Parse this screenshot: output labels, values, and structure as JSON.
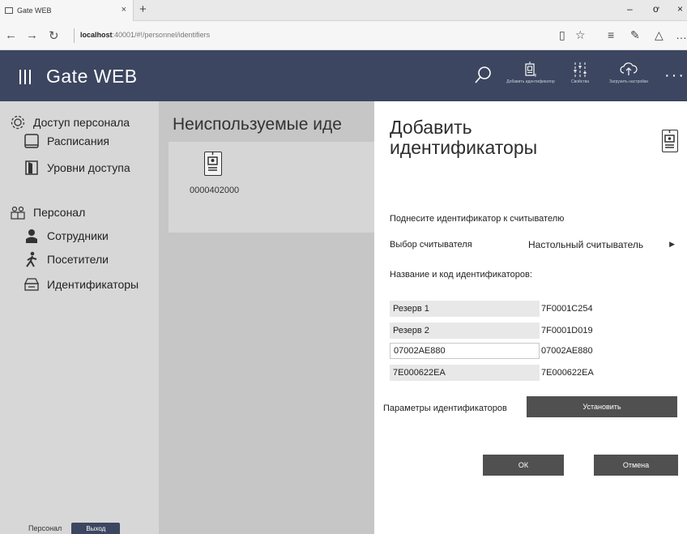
{
  "browser": {
    "tab_title": "Gate WEB",
    "tab_close": "×",
    "new_tab": "+",
    "url_host": "localhost",
    "url_rest": ":40001/#!/personnel/identifiers",
    "window_controls": [
      "–",
      "ơ",
      "×"
    ]
  },
  "header": {
    "app_title": "Gate WEB",
    "buttons": [
      {
        "label": "Добавить идентификатор",
        "icon": "add-badge-icon"
      },
      {
        "label": "Свойства",
        "icon": "properties-icon"
      },
      {
        "label": "Загрузить настройки",
        "icon": "cloud-upload-icon"
      }
    ],
    "more": "···"
  },
  "sidebar": {
    "items": [
      {
        "label": "Доступ персонала",
        "icon": "gear-icon"
      },
      {
        "label": "Расписания",
        "icon": "calendar-icon"
      },
      {
        "label": "Уровни доступа",
        "icon": "door-icon"
      },
      {
        "label": "Персонал",
        "icon": "people-icon"
      },
      {
        "label": "Сотрудники",
        "icon": "employee-icon"
      },
      {
        "label": "Посетители",
        "icon": "visitor-icon"
      },
      {
        "label": "Идентификаторы",
        "icon": "card-reader-icon"
      }
    ],
    "footer_label": "Персонал",
    "logout_label": "Выход"
  },
  "main": {
    "title": "Неиспользуемые иде",
    "badges": [
      {
        "number": "0000402000"
      }
    ]
  },
  "panel": {
    "title_line1": "Добавить",
    "title_line2": "идентификаторы",
    "instruction": "Поднесите идентификатор к считывателю",
    "reader_label": "Выбор считывателя",
    "reader_value": "Настольный считыватель",
    "names_label": "Название и код идентификаторов:",
    "identifiers": [
      {
        "name": "Резерв 1",
        "code": "7F0001C254"
      },
      {
        "name": "Резерв 2",
        "code": "7F0001D019"
      },
      {
        "name": "07002AE880",
        "code": "07002AE880"
      },
      {
        "name": "7E000622EA",
        "code": "7E000622EA"
      }
    ],
    "params_label": "Параметры идентификаторов",
    "set_button": "Установить",
    "ok_button": "ОК",
    "cancel_button": "Отмена"
  },
  "colors": {
    "header_bg": "#3c4660",
    "sidebar_bg": "#d7d7d7",
    "main_bg": "#c6c6c6",
    "button_bg": "#505050"
  }
}
